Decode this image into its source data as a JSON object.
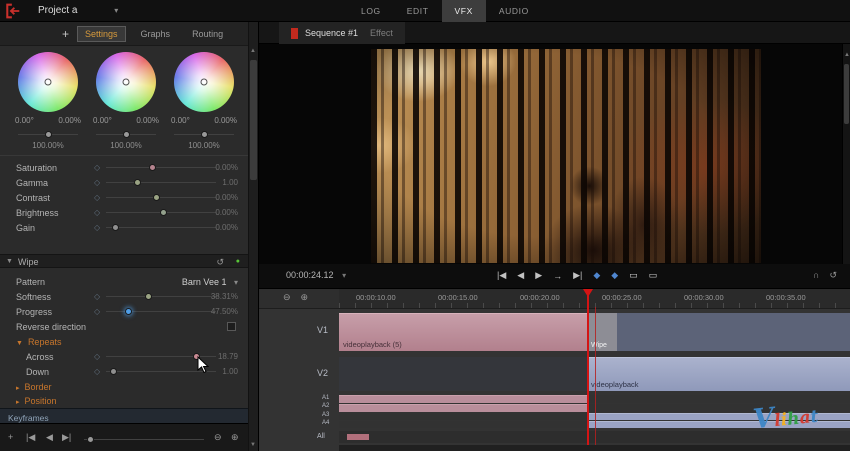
{
  "icons": {
    "plus": "+",
    "caret_down": "▾",
    "caret_right": "▸",
    "tri_down": "▼",
    "goto_start": "|◀",
    "step_back": "◀",
    "play": "▶",
    "arrow_right": "→",
    "goto_end": "▶|",
    "zoom_out": "⊖",
    "zoom_in": "⊕",
    "reset": "↺",
    "scroll_up": "▲",
    "scroll_down": "▼",
    "enabled_dot": "●",
    "keyframe": "◇",
    "mark_blue": "◆",
    "monitor": "▭",
    "loop": "↺",
    "headphone": "∩"
  },
  "topbar": {
    "project": "Project a",
    "tabs": [
      "LOG",
      "EDIT",
      "VFX",
      "AUDIO"
    ]
  },
  "left_panel": {
    "tabs": [
      "Settings",
      "Graphs",
      "Routing"
    ],
    "wheels": [
      {
        "deg": "0.00°",
        "pct": "0.00%",
        "master": "100.00%",
        "slider_pos": "50%"
      },
      {
        "deg": "0.00°",
        "pct": "0.00%",
        "master": "100.00%",
        "slider_pos": "50%"
      },
      {
        "deg": "0.00°",
        "pct": "0.00%",
        "master": "100.00%",
        "slider_pos": "50%"
      }
    ],
    "params": [
      {
        "label": "Saturation",
        "value": "0.00%",
        "pos": "42%",
        "knob_color": "#b5848f"
      },
      {
        "label": "Gamma",
        "value": "1.00",
        "pos": "28%",
        "knob_color": "#9aa383"
      },
      {
        "label": "Contrast",
        "value": "0.00%",
        "pos": "45%",
        "knob_color": "#9aa383"
      },
      {
        "label": "Brightness",
        "value": "0.00%",
        "pos": "52%",
        "knob_color": "#93a08c"
      },
      {
        "label": "Gain",
        "value": "0.00%",
        "pos": "8%",
        "knob_color": "#8f8f8f"
      }
    ],
    "wipe": {
      "title": "Wipe",
      "pattern_label": "Pattern",
      "pattern_value": "Barn Vee 1",
      "softness": {
        "label": "Softness",
        "value": "38.31%",
        "pos": "38%",
        "knob_color": "#9aa383"
      },
      "progress": {
        "label": "Progress",
        "value": "47.50%",
        "pos": "20%",
        "knob_color": "#4f9fe8"
      },
      "reverse_label": "Reverse direction",
      "repeats_label": "Repeats",
      "across": {
        "label": "Across",
        "value": "18.79",
        "pos": "82%",
        "knob_color": "#c98a93"
      },
      "down": {
        "label": "Down",
        "value": "1.00",
        "pos": "6%",
        "knob_color": "#8f8f8f"
      },
      "border_label": "Border",
      "position_label": "Position"
    },
    "keyframes_label": "Keyframes",
    "toolbar_slider_pos": "5%"
  },
  "viewer": {
    "tab_title": "Sequence #1",
    "tab_secondary": "Effect",
    "timecode": "00:00:24.12"
  },
  "timeline": {
    "ruler": [
      "00:00:10.00",
      "00:00:15.00",
      "00:00:20.00",
      "00:00:25.00",
      "00:00:30.00",
      "00:00:35.00"
    ],
    "tracks": {
      "v1": "V1",
      "v2": "V2",
      "a1": "A1",
      "a2": "A2",
      "a3": "A3",
      "a4": "A4",
      "all": "All"
    },
    "clips": {
      "v1": "videoplayback (5)",
      "wipe": "Wipe",
      "v2": "videoplayback"
    }
  },
  "watermark": {
    "letters": [
      {
        "ch": "V",
        "color": "#3d86c6"
      },
      {
        "ch": "l",
        "color": "#d33a2f"
      },
      {
        "ch": "i",
        "color": "#f5b120"
      },
      {
        "ch": "h",
        "color": "#2f9e44"
      },
      {
        "ch": "a",
        "color": "#d33a2f"
      },
      {
        "ch": "t",
        "color": "#3d86c6"
      }
    ]
  },
  "colors": {
    "accent_orange": "#d79a3c",
    "section_orange": "#c8762c",
    "playhead_red": "#d41414",
    "clip_pink": "#bb8f9c",
    "clip_blue": "#99a2c0",
    "enabled_green": "#57c437"
  }
}
